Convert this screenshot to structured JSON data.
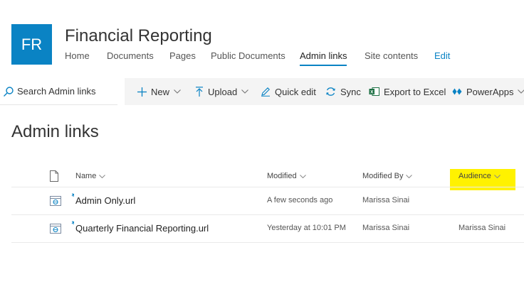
{
  "site": {
    "logo_initials": "FR",
    "title": "Financial Reporting",
    "nav": [
      "Home",
      "Documents",
      "Pages",
      "Public Documents",
      "Admin links",
      "Site contents"
    ],
    "active_nav": "Admin links",
    "edit_label": "Edit",
    "accent_color": "#0a83c4"
  },
  "search": {
    "placeholder": "Search Admin links",
    "icon": "search-icon"
  },
  "commands": {
    "new": "New",
    "upload": "Upload",
    "quick_edit": "Quick edit",
    "sync": "Sync",
    "export": "Export to Excel",
    "powerapps": "PowerApps"
  },
  "page": {
    "heading": "Admin links"
  },
  "list": {
    "columns": {
      "name": "Name",
      "modified": "Modified",
      "modified_by": "Modified By",
      "audience": "Audience"
    },
    "highlight_color": "#fff200",
    "rows": [
      {
        "name": "Admin Only.url",
        "modified": "A few seconds ago",
        "modified_by": "Marissa Sinai",
        "audience": ""
      },
      {
        "name": "Quarterly Financial Reporting.url",
        "modified": "Yesterday at 10:01 PM",
        "modified_by": "Marissa Sinai",
        "audience": "Marissa Sinai"
      }
    ]
  }
}
